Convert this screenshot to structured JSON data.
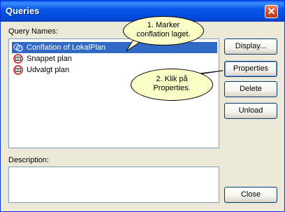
{
  "window": {
    "title": "Queries"
  },
  "query_names": {
    "label": "Query Names:",
    "items": [
      {
        "label": "Conflation of  LokalPlan",
        "icon": "conflation-query-icon",
        "selected": true
      },
      {
        "label": "Snappet plan",
        "icon": "query-icon",
        "selected": false
      },
      {
        "label": "Udvalgt plan",
        "icon": "query-icon",
        "selected": false
      }
    ]
  },
  "description": {
    "label": "Description:",
    "value": ""
  },
  "buttons": {
    "display": "Display...",
    "properties": "Properties",
    "delete": "Delete",
    "unload": "Unload",
    "close": "Close"
  },
  "callouts": [
    {
      "text_line1": "1. Marker",
      "text_line2": "conflation laget."
    },
    {
      "text_line1": "2. Klik på",
      "text_line2": "Properties."
    }
  ],
  "colors": {
    "selection": "#316ac5",
    "callout_fill": "#fdfdc8",
    "title_bar": "#0a58e8"
  }
}
